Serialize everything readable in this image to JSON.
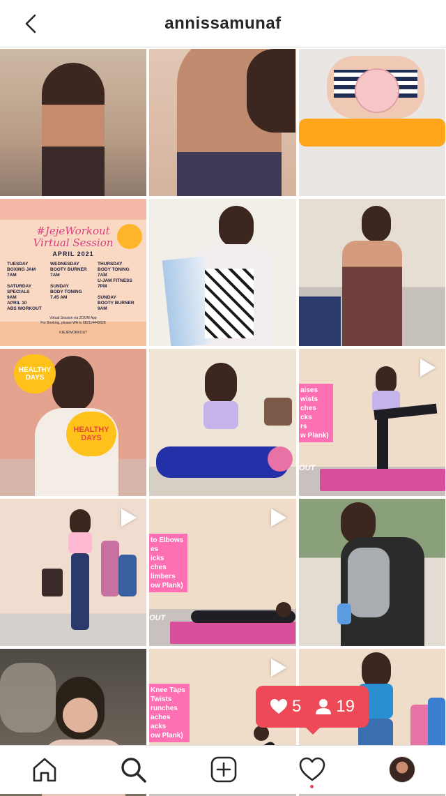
{
  "header": {
    "username": "annissamunaf"
  },
  "icons": {
    "back": "chevron-left-icon",
    "home": "home-icon",
    "search": "search-icon",
    "new_post": "add-post-icon",
    "activity": "heart-icon",
    "profile": "profile-avatar"
  },
  "poster": {
    "title": "#JejeWorkout\nVirtual Session",
    "month": "APRIL 2021",
    "col1": "TUESDAY\nBOXING JAM\n7AM\n\nSATURDAY\nSPECIALS\n9AM\nAPRIL 10\nABS WORKOUT",
    "col2": "WEDNESDAY\nBOOTY BURNER\n7AM\n\nSUNDAY\nBODY TONING\n7.45 AM",
    "col3": "THURSDAY\nBODY TONING\n7AM\nU-JAM FITNESS\n7PM\n\nSUNDAY\nBOOTY BURNER\n9AM",
    "footer": "Virtual Session via ZOOM App\nFor Booking, please WA to 082114443028\n\n#JEJEWORKOUT"
  },
  "video_overlays": {
    "tile9": "aises\nwists\nches\ncks\nrs\nw Plank)",
    "tile11": "to Elbows\nes\nicks\nches\nlimbers\now Plank)",
    "tile14": "Knee Taps\nTwists\nrunches\naches\nacks\now Plank)",
    "brand": "OUT"
  },
  "stickers": {
    "healthy_days": "HEALTHY DAYS"
  },
  "activity": {
    "likes": "5",
    "follows": "19"
  },
  "colors": {
    "accent": "#ed4956",
    "border": "#dbdbdb",
    "text": "#262626"
  }
}
